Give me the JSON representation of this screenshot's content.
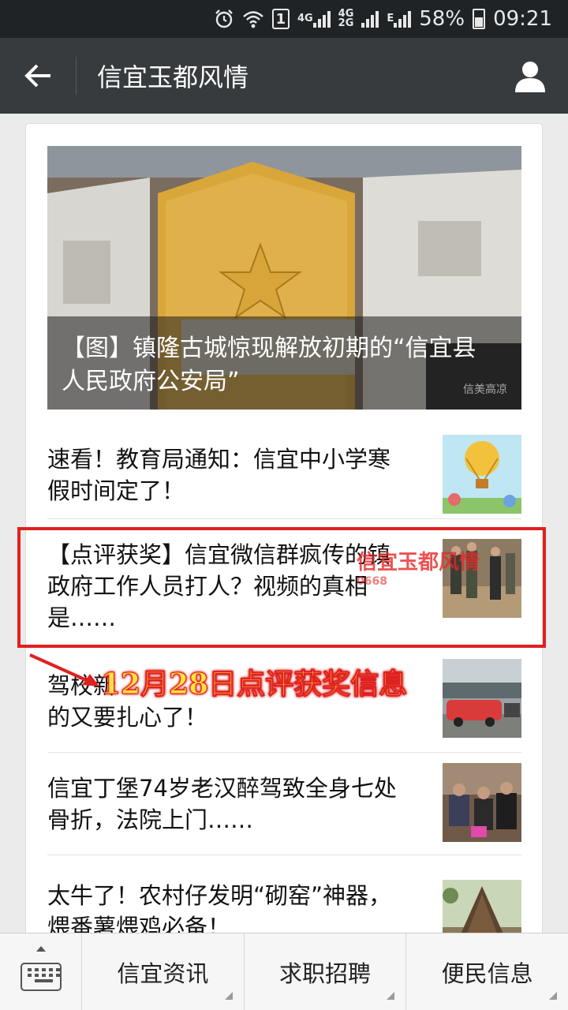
{
  "status_bar": {
    "network_4g": "4G",
    "network_4g2g_top": "4G",
    "network_4g2g_bottom": "2G",
    "sim": "1",
    "edge": "E",
    "battery_percent": "58%",
    "battery_level": 0.58,
    "time": "09:21",
    "icons": [
      "alarm-icon",
      "wifi-icon",
      "sim-icon",
      "signal-icon",
      "battery-icon"
    ]
  },
  "header": {
    "title": "信宜玉都风情",
    "back_icon": "arrow-left-icon",
    "profile_icon": "person-icon"
  },
  "cover": {
    "caption_line1": "【图】镇隆古城惊现解放初期的“信宜县",
    "caption_line2": "人民政府公安局”",
    "watermark": "信美高凉"
  },
  "articles": [
    {
      "line1": "速看！教育局通知：信宜中小学寒",
      "line2": "假时间定了！",
      "line3": ""
    },
    {
      "line1": "【点评获奖】信宜微信群疯传的镇",
      "line2": "政府工作人员打人？视频的真相",
      "line3": "是……"
    },
    {
      "line1": "驾校新",
      "line2": "的又要扎心了！",
      "line3": ""
    },
    {
      "line1": "信宜丁堡74岁老汉醉驾致全身七处",
      "line2": "骨折，法院上门……",
      "line3": ""
    },
    {
      "line1": "太牛了！农村仔发明“砌窑”神器，",
      "line2": "煨番薯煨鸡必备！",
      "line3": ""
    }
  ],
  "annotation": {
    "overlay_text": "12月28日点评获奖信息",
    "site_watermark": "信宜玉都风情",
    "site_watermark_sub": "0668"
  },
  "bottom_nav": {
    "keyboard_icon": "keyboard-icon",
    "items": [
      "信宜资讯",
      "求职招聘",
      "便民信息"
    ]
  },
  "colors": {
    "status_bar": "#202326",
    "title_bar": "#373b3e",
    "highlight": "#e02020",
    "overlay_text": "#ffe23c"
  }
}
